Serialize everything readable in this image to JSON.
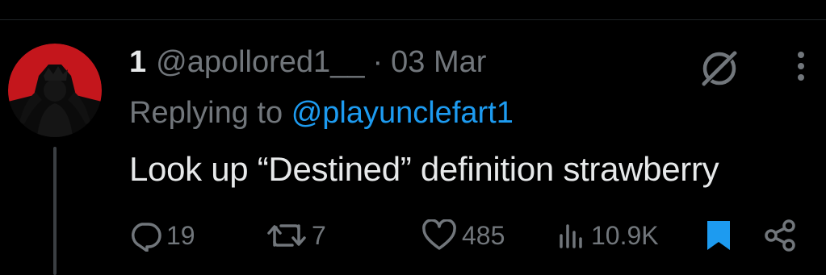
{
  "colors": {
    "background": "#000000",
    "text": "#e7e9ea",
    "muted": "#71767b",
    "accent": "#1d9bf0",
    "avatar_red": "#c4161c"
  },
  "tweet": {
    "display_name": "1",
    "handle": "@apollored1__",
    "separator": "·",
    "date": "03 Mar",
    "replying_to_label": "Replying to",
    "replying_to_handle": "@playunclefart1",
    "text": "Look up “Destined” definition strawberry"
  },
  "actions": {
    "reply_count": "19",
    "retweet_count": "7",
    "like_count": "485",
    "view_count": "10.9K"
  },
  "icons": {
    "avatar": "avatar-image",
    "grok": "grok-icon",
    "more": "more-vertical-icon",
    "reply": "reply-icon",
    "retweet": "retweet-icon",
    "like": "heart-icon",
    "views": "views-icon",
    "bookmark": "bookmark-icon",
    "share": "share-icon"
  }
}
